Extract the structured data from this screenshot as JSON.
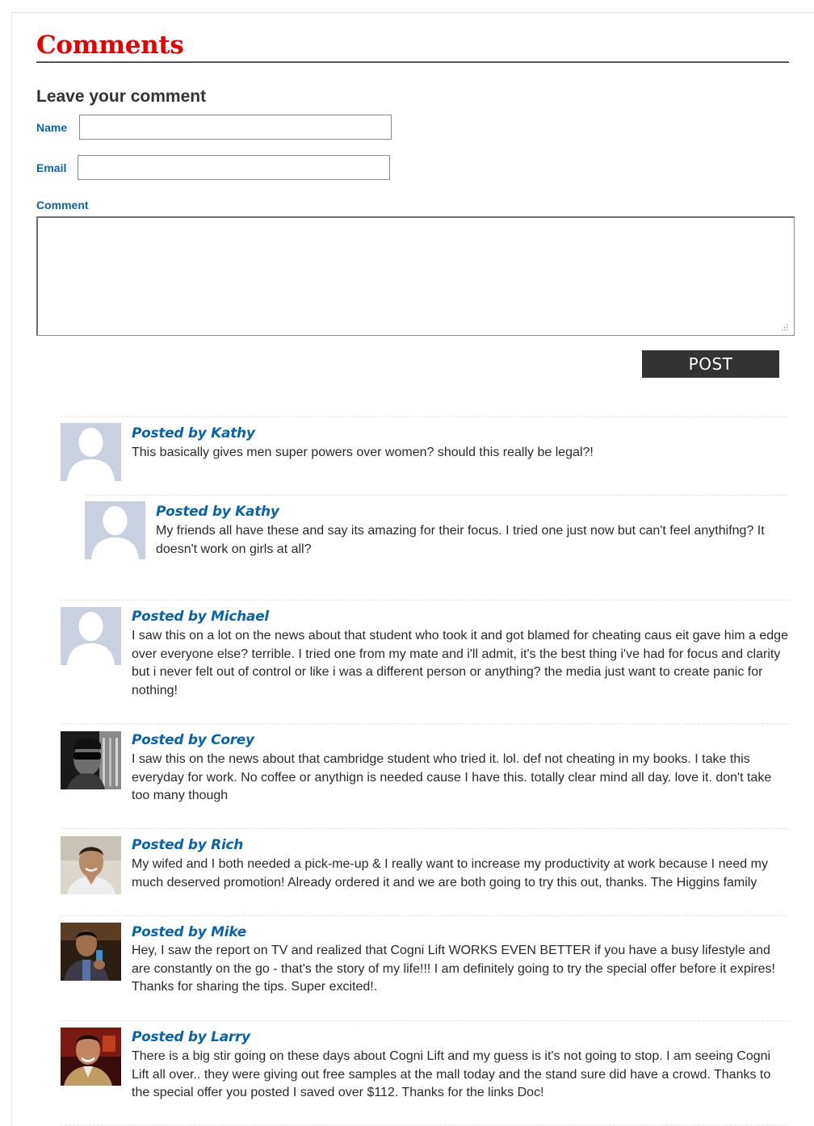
{
  "section": {
    "title": "Comments",
    "form_title": "Leave your comment",
    "name_label": "Name",
    "email_label": "Email",
    "comment_label": "Comment",
    "name_value": "",
    "email_value": "",
    "comment_value": "",
    "post_label": "POST"
  },
  "comments": [
    {
      "author": "Posted by Kathy",
      "text": "This basically gives men super powers over women? should this really be legal?!",
      "avatar": "default-silhouette"
    },
    {
      "author": "Posted by Kathy",
      "text": "My friends all have these and say its amazing for their focus. I tried one just now but can't feel anythifng? It doesn't work on girls at all?",
      "avatar": "default-silhouette"
    },
    {
      "author": "Posted by Michael",
      "text": "I saw this on a lot on the news about that student who took it and got blamed for cheating caus eit gave him a edge over everyone else? terrible. I tried one from my mate and i'll admit, it's the best thing i've had for focus and clarity but i never felt out of control or like i was a different person or anything? the media just want to create panic for nothing!",
      "avatar": "default-silhouette"
    },
    {
      "author": "Posted by Corey",
      "text": "I saw this on the news about that cambridge student who tried it. lol. def not cheating in my books. I take this everyday for work. No coffee or anythign is needed cause I have this. totally clear mind all day. love it. don't take too many though",
      "avatar": "photo-man-sunglasses"
    },
    {
      "author": "Posted by Rich",
      "text": "My wifed and I both needed a pick-me-up & I really want to increase my productivity at work because I need my much deserved promotion! Already ordered it and we are both going to try this out, thanks. The Higgins family",
      "avatar": "photo-man-smiling"
    },
    {
      "author": "Posted by Mike",
      "text": "Hey, I saw the report on TV and realized that Cogni Lift WORKS EVEN BETTER if you have a busy lifestyle and are constantly on the go - that's the story of my life!!! I am definitely going to try the special offer before it expires! Thanks for sharing the tips. Super excited!.",
      "avatar": "photo-man-selfie"
    },
    {
      "author": "Posted by Larry",
      "text": "There is a big stir going on these days about Cogni Lift and my guess is it's not going to stop. I am seeing Cogni Lift all over.. they were giving out free samples at the mall today and the stand sure did have a crowd. Thanks to the special offer you posted I saved over $112. Thanks for the links Doc!",
      "avatar": "photo-man-red"
    }
  ],
  "colors": {
    "heading": "#e60000",
    "label": "#0a64a8",
    "button_bg": "#333333"
  }
}
